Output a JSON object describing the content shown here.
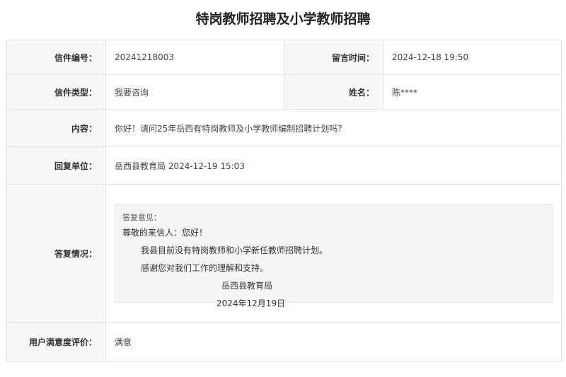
{
  "page": {
    "title": "特岗教师招聘及小学教师招聘"
  },
  "fields": {
    "letter_no_label": "信件编号：",
    "letter_no": "20241218003",
    "msg_time_label": "留言时间：",
    "msg_time": "2024-12-18 19:50",
    "letter_type_label": "信件类型：",
    "letter_type": "我要咨询",
    "name_label": "姓名：",
    "name": "陈****",
    "content_label": "内容：",
    "content": "你好！请问25年岳西有特岗教师及小学教师编制招聘计划吗？",
    "reply_unit_label": "回复单位：",
    "reply_unit": "岳西县教育局 2024-12-19 15:03",
    "reply_label": "答复情况：",
    "rating_label": "用户满意度评价：",
    "rating": "满意"
  },
  "reply": {
    "head": "答复意见：",
    "greeting": "尊敬的来信人：您好！",
    "line1": "我县目前没有特岗教师和小学新任教师招聘计划。",
    "line2": "感谢您对我们工作的理解和支持。",
    "signature": "岳西县教育局",
    "date": "2024年12月19日"
  },
  "colors": {
    "label_bg": "#f7f7f7",
    "border": "#e3e3e3",
    "reply_bg": "#f5f5f5",
    "rating": "#cc0000"
  }
}
